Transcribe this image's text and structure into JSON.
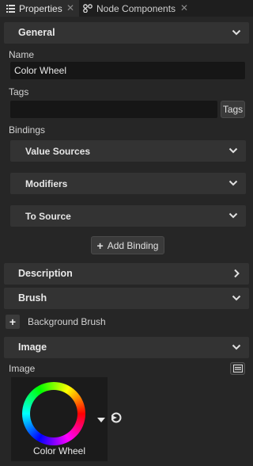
{
  "tabs": [
    {
      "label": "Properties",
      "icon": "list-icon",
      "active": true
    },
    {
      "label": "Node Components",
      "icon": "components-icon",
      "active": false
    }
  ],
  "general": {
    "title": "General",
    "name_label": "Name",
    "name_value": "Color Wheel",
    "tags_label": "Tags",
    "tags_value": "",
    "tags_button": "Tags",
    "bindings_label": "Bindings",
    "value_sources": "Value Sources",
    "modifiers": "Modifiers",
    "to_source": "To Source",
    "add_binding": "Add Binding"
  },
  "description": {
    "title": "Description"
  },
  "brush": {
    "title": "Brush",
    "background_brush": "Background Brush"
  },
  "image": {
    "title": "Image",
    "image_label": "Image",
    "thumbnail_label": "Color Wheel"
  },
  "colors": {
    "background": "#262626",
    "section": "#333333",
    "field": "#161616"
  }
}
